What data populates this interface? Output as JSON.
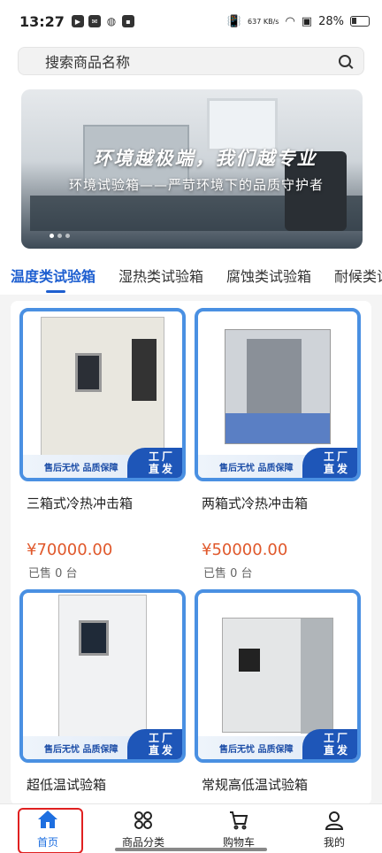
{
  "status_bar": {
    "time": "13:27",
    "net_speed": "637 KB/s",
    "battery": "28%"
  },
  "search": {
    "placeholder": "搜索商品名称"
  },
  "banner": {
    "slogan": "环境越极端，我们越专业",
    "subtitle": "环境试验箱——严苛环境下的品质守护者"
  },
  "tabs": [
    {
      "label": "温度类试验箱",
      "active": true
    },
    {
      "label": "湿热类试验箱",
      "active": false
    },
    {
      "label": "腐蚀类试验箱",
      "active": false
    },
    {
      "label": "耐候类试验箱",
      "active": false
    }
  ],
  "products": [
    {
      "title": "三箱式冷热冲击箱",
      "price": "¥70000.00",
      "sold": "已售 0 台",
      "promo": "售后无忧 品质保障",
      "badge_line1": "工厂",
      "badge_line2": "直发"
    },
    {
      "title": "两箱式冷热冲击箱",
      "price": "¥50000.00",
      "sold": "已售 0 台",
      "promo": "售后无忧 品质保障",
      "badge_line1": "工厂",
      "badge_line2": "直发"
    },
    {
      "title": "超低温试验箱",
      "promo": "售后无忧 品质保障",
      "badge_line1": "工厂",
      "badge_line2": "直发"
    },
    {
      "title": "常规高低温试验箱",
      "promo": "售后无忧 品质保障",
      "badge_line1": "工厂",
      "badge_line2": "直发"
    }
  ],
  "tabbar": {
    "home": "首页",
    "category": "商品分类",
    "cart": "购物车",
    "mine": "我的"
  },
  "colors": {
    "accent": "#1e5fd0",
    "price": "#e0582b",
    "frame": "#4a90e2",
    "highlight": "#e02020"
  }
}
